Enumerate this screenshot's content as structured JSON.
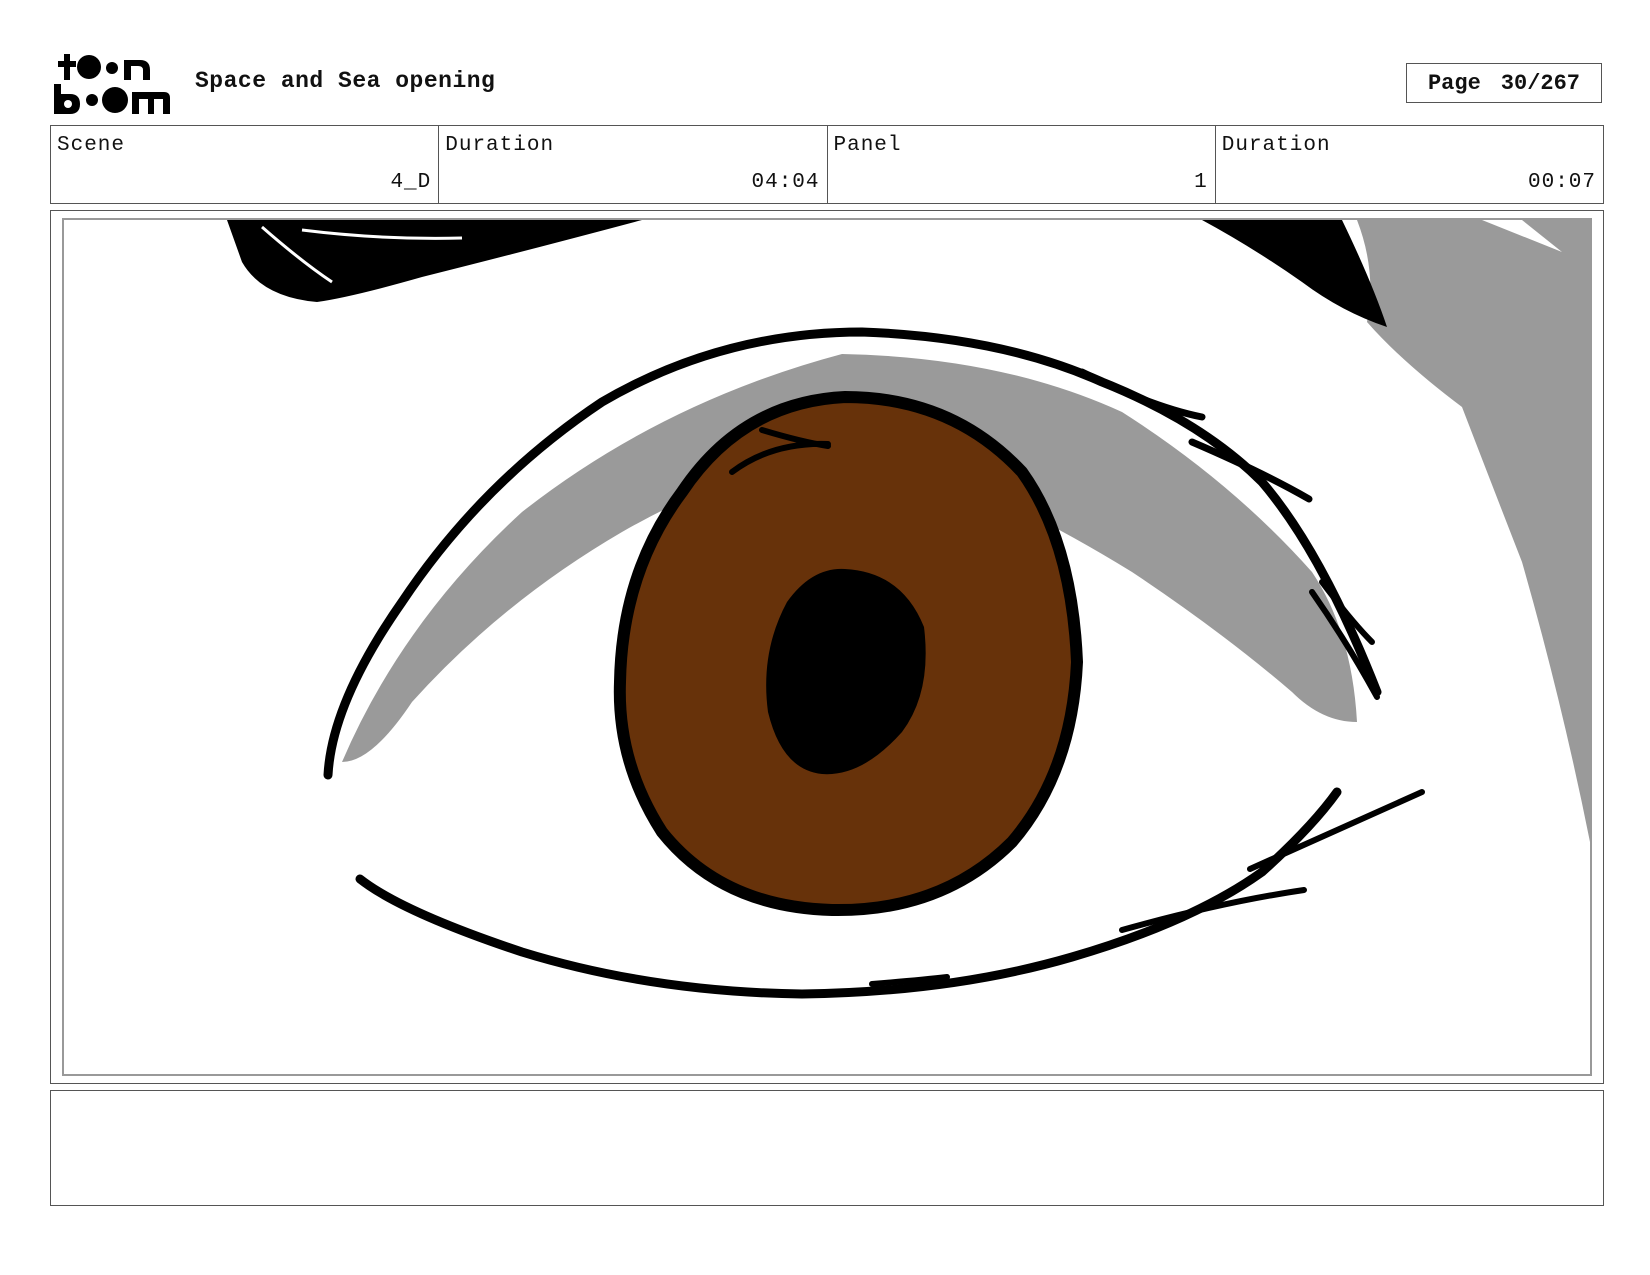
{
  "header": {
    "project_title": "Space and Sea opening",
    "page_label": "Page",
    "page_value": "30/267"
  },
  "info": {
    "scene_label": "Scene",
    "scene_value": "4_D",
    "scene_duration_label": "Duration",
    "scene_duration_value": "04:04",
    "panel_label": "Panel",
    "panel_value": "1",
    "panel_duration_label": "Duration",
    "panel_duration_value": "00:07"
  },
  "logo": {
    "text": "toonboom"
  },
  "colors": {
    "iris": "#67320a",
    "lid_shadow": "#9a9a9a",
    "ink": "#000000"
  }
}
